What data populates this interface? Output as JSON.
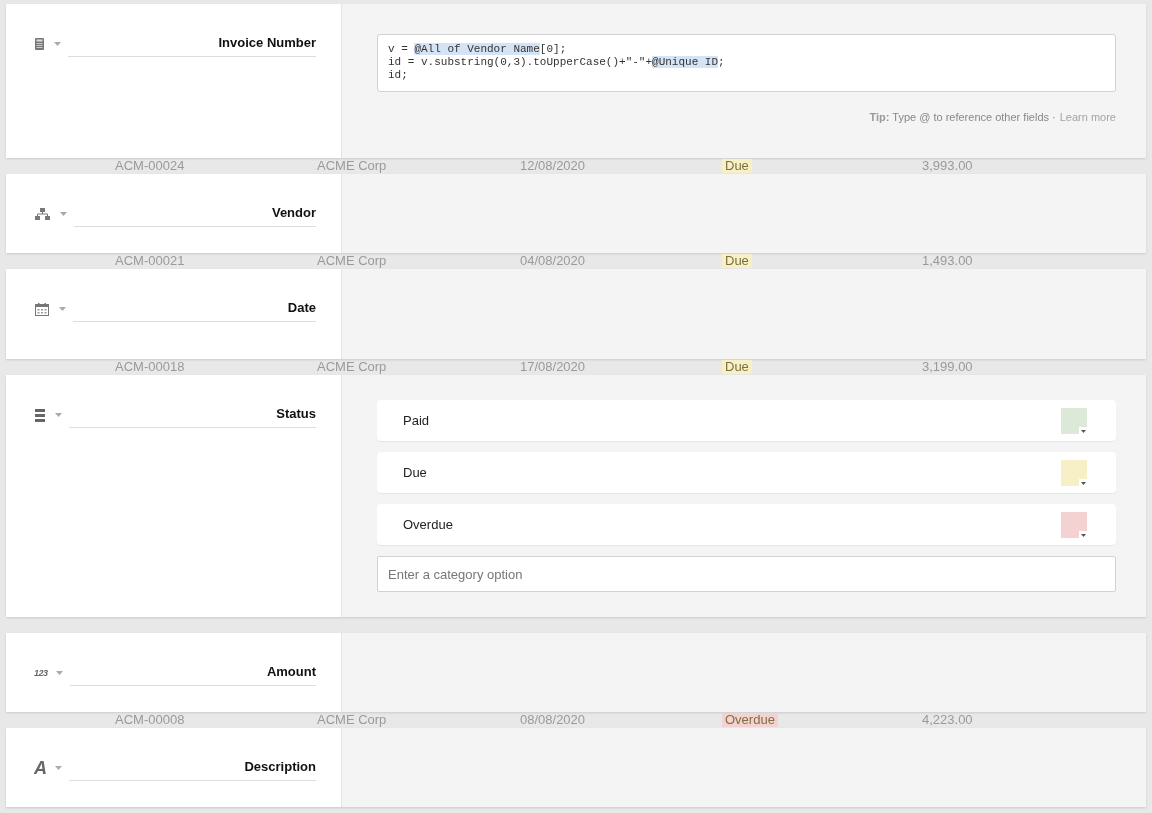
{
  "fields": [
    {
      "kind": "formula",
      "name": "Invoice Number",
      "formula": [
        [
          {
            "text": "v = ",
            "ref": false
          },
          {
            "text": "@All of Vendor Name",
            "ref": true
          },
          {
            "text": "[0];",
            "ref": false
          }
        ],
        [
          {
            "text": "id = v.substring(0,3).toUpperCase()+\"-\"+",
            "ref": false
          },
          {
            "text": "@Unique ID",
            "ref": true
          },
          {
            "text": ";",
            "ref": false
          }
        ],
        [
          {
            "text": "id;",
            "ref": false
          }
        ]
      ],
      "tip": {
        "label": "Tip:",
        "text": "Type @ to reference other fields ·",
        "link": "Learn more"
      },
      "row_beneath": {
        "id": "ACM-00024",
        "vendor": "ACME Corp",
        "date": "12/08/2020",
        "status": "Due",
        "color": "#f7f0c6",
        "amount": "3,993.00"
      }
    },
    {
      "kind": "link",
      "name": "Vendor",
      "row_beneath": {
        "id": "ACM-00021",
        "vendor": "ACME Corp",
        "date": "04/08/2020",
        "status": "Due",
        "color": "#f7f0c6",
        "amount": "1,493.00"
      }
    },
    {
      "kind": "date",
      "name": "Date",
      "row_beneath": {
        "id": "ACM-00018",
        "vendor": "ACME Corp",
        "date": "17/08/2020",
        "status": "Due",
        "color": "#f7f0c6",
        "amount": "3,199.00"
      }
    },
    {
      "kind": "category",
      "name": "Status",
      "options": [
        {
          "label": "Paid",
          "color": "#dce9d8"
        },
        {
          "label": "Due",
          "color": "#f7f0c6"
        },
        {
          "label": "Overdue",
          "color": "#f5d2d2"
        }
      ],
      "placeholder": "Enter a category option"
    },
    {
      "kind": "number",
      "name": "Amount",
      "icon_text": "123",
      "row_beneath": {
        "id": "ACM-00008",
        "vendor": "ACME Corp",
        "date": "08/08/2020",
        "status": "Overdue",
        "color": "#f5d2d2",
        "amount": "4,223.00"
      }
    },
    {
      "kind": "text",
      "name": "Description",
      "icon_text": "A"
    }
  ]
}
